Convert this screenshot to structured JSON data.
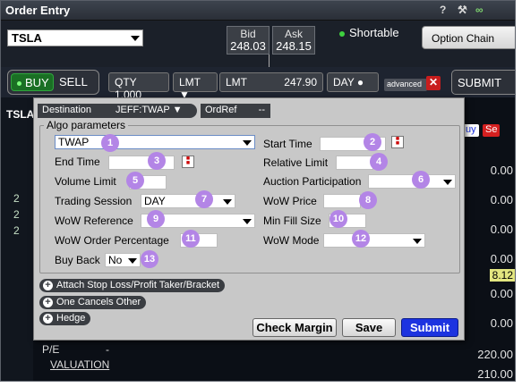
{
  "window": {
    "title": "Order Entry",
    "help_icon": "?"
  },
  "quote": {
    "symbol": "TSLA",
    "bid_label": "Bid",
    "bid": "248.03",
    "ask_label": "Ask",
    "ask": "248.15",
    "shortable": "Shortable",
    "option_chain": "Option Chain"
  },
  "order_bar": {
    "buy": "BUY",
    "sell": "SELL",
    "qty": "QTY 1,000",
    "type": "LMT",
    "lmt_label": "LMT",
    "price": "247.90",
    "tif": "DAY",
    "advanced": "advanced",
    "submit": "SUBMIT"
  },
  "destination": {
    "label": "Destination",
    "value": "JEFF:TWAP",
    "ordref_label": "OrdRef",
    "ordref_value": "--"
  },
  "algo": {
    "legend": "Algo parameters",
    "strategy": "TWAP",
    "fields": {
      "start_time": "Start Time",
      "end_time": "End Time",
      "relative_limit": "Relative Limit",
      "volume_limit": "Volume Limit",
      "auction_participation": "Auction Participation",
      "trading_session": "Trading Session",
      "trading_session_value": "DAY",
      "wow_price": "WoW Price",
      "wow_reference": "WoW Reference",
      "min_fill_size": "Min Fill Size",
      "wow_order_percentage": "WoW Order Percentage",
      "wow_mode": "WoW Mode",
      "buy_back": "Buy Back",
      "buy_back_value": "No"
    },
    "badges": [
      "1",
      "2",
      "3",
      "4",
      "5",
      "6",
      "7",
      "8",
      "9",
      "10",
      "11",
      "12",
      "13"
    ]
  },
  "attachments": {
    "stop_loss": "Attach Stop Loss/Profit Taker/Bracket",
    "oco": "One Cancels Other",
    "hedge": "Hedge"
  },
  "buttons": {
    "check_margin": "Check Margin",
    "save": "Save",
    "submit": "Submit"
  },
  "background": {
    "tab": "TSLA",
    "prices": [
      "0.00",
      "0.00",
      "0.00",
      "0.00",
      "0.00",
      "0.00",
      "0.00",
      "220.00",
      "210.00"
    ],
    "highlight": "8.12",
    "chip_buy": "uy",
    "chip_sell": "Se",
    "left_values": [
      "2",
      "2",
      "2"
    ],
    "pe_label": "P/E",
    "pe_value": "-",
    "valuation": "VALUATION"
  },
  "colors": {
    "buy_green": "#1a6f24",
    "submit_blue": "#1c33e0",
    "badge_purple": "#b385e6",
    "close_red": "#c81d1d"
  }
}
